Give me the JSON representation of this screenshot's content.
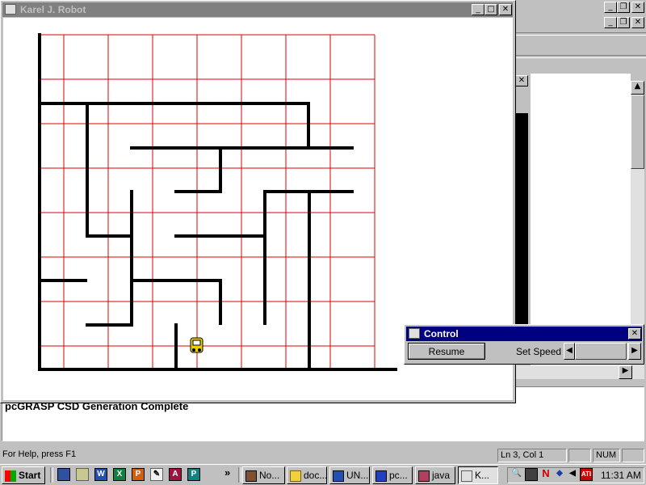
{
  "karel_window": {
    "title": "Karel J. Robot"
  },
  "control_window": {
    "title": "Control",
    "resume_label": "Resume",
    "speed_label": "Set Speed"
  },
  "output_text": "pcGRASP CSD Generation Complete",
  "status_bar": {
    "help": "For Help, press F1",
    "position": "Ln 3, Col 1",
    "num": "NUM"
  },
  "taskbar": {
    "start": "Start",
    "overflow": "»",
    "clock": "11:31 AM",
    "buttons": [
      {
        "label": "No...",
        "icon": "notepad-icon"
      },
      {
        "label": "doc...",
        "icon": "folder-icon"
      },
      {
        "label": "UN...",
        "icon": "word-document-icon"
      },
      {
        "label": "pc...",
        "icon": "pcgrasp-icon"
      },
      {
        "label": "java",
        "icon": "java-console-icon"
      },
      {
        "label": "K...",
        "icon": "java-cup-icon"
      }
    ]
  },
  "colors": {
    "grid": "#dd0000",
    "wall": "#000000",
    "active_title": "#000080",
    "inactive_title": "#808080",
    "robot": "#e8d000"
  }
}
